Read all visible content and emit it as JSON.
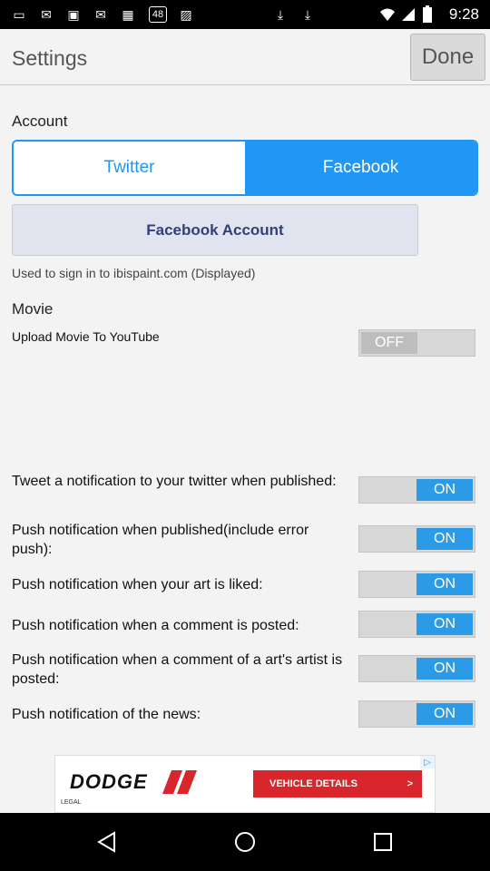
{
  "status_bar": {
    "time": "9:28",
    "notification_icons": [
      "message-icon",
      "email-icon",
      "photo-icon",
      "email-icon",
      "calendar-icon",
      "notification-48-icon",
      "image-icon",
      "download-icon",
      "download-icon"
    ],
    "notification_glyphs": [
      "▭",
      "✉",
      "▣",
      "✉",
      "▦",
      "48",
      "▨",
      "⤓",
      "⤓"
    ]
  },
  "header": {
    "title": "Settings",
    "done_label": "Done"
  },
  "account": {
    "section_label": "Account",
    "tabs": [
      "Twitter",
      "Facebook"
    ],
    "selected_tab": "Facebook",
    "fb_button_label": "Facebook Account",
    "hint": "Used to sign in to ibispaint.com (Displayed)"
  },
  "movie": {
    "section_label": "Movie",
    "upload_label": "Upload Movie To YouTube",
    "upload_state": "OFF"
  },
  "notifications": [
    {
      "label": "Tweet a notification to your twitter when published:",
      "state": "ON"
    },
    {
      "label": "Push notification when published(include error push):",
      "state": "ON"
    },
    {
      "label": "Push notification when your art is liked:",
      "state": "ON"
    },
    {
      "label": "Push notification when a comment is posted:",
      "state": "ON"
    },
    {
      "label": "Push notification when a comment of a art's artist is posted:",
      "state": "ON"
    },
    {
      "label": "Push notification of the news:",
      "state": "ON"
    }
  ],
  "ad": {
    "brand": "DODGE",
    "cta": "VEHICLE DETAILS",
    "cta_arrow": ">",
    "legal": "LEGAL"
  },
  "colors": {
    "accent": "#2196f3",
    "toggle_on": "#2b9be8",
    "ad_red": "#d8262c"
  }
}
